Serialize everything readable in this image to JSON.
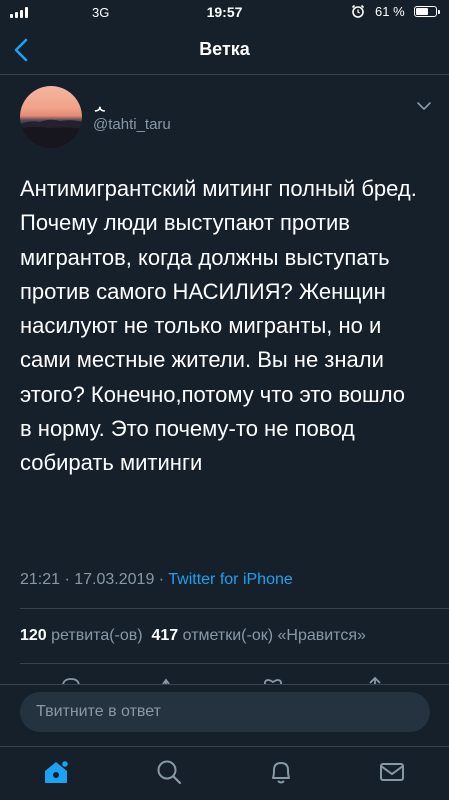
{
  "status_bar": {
    "network": "3G",
    "time": "19:57",
    "battery_text": "61 %",
    "battery_level": 0.61
  },
  "nav": {
    "title": "Ветка",
    "back_icon": "chevron-left-icon"
  },
  "tweet": {
    "author_name": "ᆺ",
    "handle": "@tahti_taru",
    "text": "Антимигрантский митинг полный бред. Почему люди выступают против мигрантов, когда должны выступать против самого НАСИЛИЯ? Женщин насилуют не только мигранты, но и сами местные жители. Вы не знали этого? Конечно,потому что это вошло в норму. Это почему-то не повод собирать митинги",
    "timestamp": "21:21 · 17.03.2019 · ",
    "source": "Twitter for iPhone",
    "retweets_count": "120",
    "retweets_label": " ретвита(-ов)",
    "likes_count": "417",
    "likes_label": " отметки(-ок) «Нравится»"
  },
  "reply": {
    "placeholder": "Твитните в ответ"
  },
  "tabs": [
    {
      "name": "home",
      "icon": "home-icon",
      "active": true
    },
    {
      "name": "search",
      "icon": "search-icon"
    },
    {
      "name": "notifications",
      "icon": "bell-icon"
    },
    {
      "name": "messages",
      "icon": "envelope-icon"
    }
  ],
  "colors": {
    "background": "#15202b",
    "accent": "#1da1f2",
    "secondary_text": "#8899a6",
    "divider": "#38444d"
  }
}
